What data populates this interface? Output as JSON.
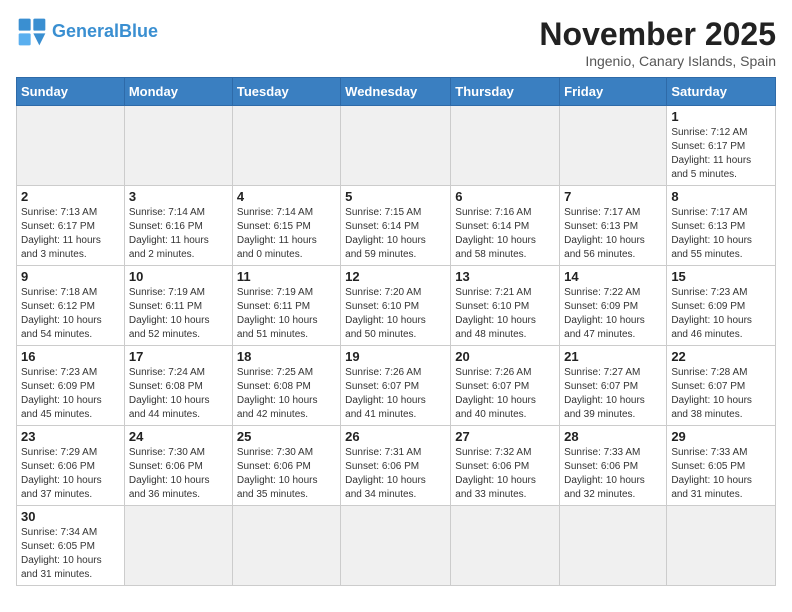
{
  "header": {
    "logo_general": "General",
    "logo_blue": "Blue",
    "month_title": "November 2025",
    "location": "Ingenio, Canary Islands, Spain"
  },
  "days_of_week": [
    "Sunday",
    "Monday",
    "Tuesday",
    "Wednesday",
    "Thursday",
    "Friday",
    "Saturday"
  ],
  "weeks": [
    [
      {
        "day": "",
        "info": ""
      },
      {
        "day": "",
        "info": ""
      },
      {
        "day": "",
        "info": ""
      },
      {
        "day": "",
        "info": ""
      },
      {
        "day": "",
        "info": ""
      },
      {
        "day": "",
        "info": ""
      },
      {
        "day": "1",
        "info": "Sunrise: 7:12 AM\nSunset: 6:17 PM\nDaylight: 11 hours\nand 5 minutes."
      }
    ],
    [
      {
        "day": "2",
        "info": "Sunrise: 7:13 AM\nSunset: 6:17 PM\nDaylight: 11 hours\nand 3 minutes."
      },
      {
        "day": "3",
        "info": "Sunrise: 7:14 AM\nSunset: 6:16 PM\nDaylight: 11 hours\nand 2 minutes."
      },
      {
        "day": "4",
        "info": "Sunrise: 7:14 AM\nSunset: 6:15 PM\nDaylight: 11 hours\nand 0 minutes."
      },
      {
        "day": "5",
        "info": "Sunrise: 7:15 AM\nSunset: 6:14 PM\nDaylight: 10 hours\nand 59 minutes."
      },
      {
        "day": "6",
        "info": "Sunrise: 7:16 AM\nSunset: 6:14 PM\nDaylight: 10 hours\nand 58 minutes."
      },
      {
        "day": "7",
        "info": "Sunrise: 7:17 AM\nSunset: 6:13 PM\nDaylight: 10 hours\nand 56 minutes."
      },
      {
        "day": "8",
        "info": "Sunrise: 7:17 AM\nSunset: 6:13 PM\nDaylight: 10 hours\nand 55 minutes."
      }
    ],
    [
      {
        "day": "9",
        "info": "Sunrise: 7:18 AM\nSunset: 6:12 PM\nDaylight: 10 hours\nand 54 minutes."
      },
      {
        "day": "10",
        "info": "Sunrise: 7:19 AM\nSunset: 6:11 PM\nDaylight: 10 hours\nand 52 minutes."
      },
      {
        "day": "11",
        "info": "Sunrise: 7:19 AM\nSunset: 6:11 PM\nDaylight: 10 hours\nand 51 minutes."
      },
      {
        "day": "12",
        "info": "Sunrise: 7:20 AM\nSunset: 6:10 PM\nDaylight: 10 hours\nand 50 minutes."
      },
      {
        "day": "13",
        "info": "Sunrise: 7:21 AM\nSunset: 6:10 PM\nDaylight: 10 hours\nand 48 minutes."
      },
      {
        "day": "14",
        "info": "Sunrise: 7:22 AM\nSunset: 6:09 PM\nDaylight: 10 hours\nand 47 minutes."
      },
      {
        "day": "15",
        "info": "Sunrise: 7:23 AM\nSunset: 6:09 PM\nDaylight: 10 hours\nand 46 minutes."
      }
    ],
    [
      {
        "day": "16",
        "info": "Sunrise: 7:23 AM\nSunset: 6:09 PM\nDaylight: 10 hours\nand 45 minutes."
      },
      {
        "day": "17",
        "info": "Sunrise: 7:24 AM\nSunset: 6:08 PM\nDaylight: 10 hours\nand 44 minutes."
      },
      {
        "day": "18",
        "info": "Sunrise: 7:25 AM\nSunset: 6:08 PM\nDaylight: 10 hours\nand 42 minutes."
      },
      {
        "day": "19",
        "info": "Sunrise: 7:26 AM\nSunset: 6:07 PM\nDaylight: 10 hours\nand 41 minutes."
      },
      {
        "day": "20",
        "info": "Sunrise: 7:26 AM\nSunset: 6:07 PM\nDaylight: 10 hours\nand 40 minutes."
      },
      {
        "day": "21",
        "info": "Sunrise: 7:27 AM\nSunset: 6:07 PM\nDaylight: 10 hours\nand 39 minutes."
      },
      {
        "day": "22",
        "info": "Sunrise: 7:28 AM\nSunset: 6:07 PM\nDaylight: 10 hours\nand 38 minutes."
      }
    ],
    [
      {
        "day": "23",
        "info": "Sunrise: 7:29 AM\nSunset: 6:06 PM\nDaylight: 10 hours\nand 37 minutes."
      },
      {
        "day": "24",
        "info": "Sunrise: 7:30 AM\nSunset: 6:06 PM\nDaylight: 10 hours\nand 36 minutes."
      },
      {
        "day": "25",
        "info": "Sunrise: 7:30 AM\nSunset: 6:06 PM\nDaylight: 10 hours\nand 35 minutes."
      },
      {
        "day": "26",
        "info": "Sunrise: 7:31 AM\nSunset: 6:06 PM\nDaylight: 10 hours\nand 34 minutes."
      },
      {
        "day": "27",
        "info": "Sunrise: 7:32 AM\nSunset: 6:06 PM\nDaylight: 10 hours\nand 33 minutes."
      },
      {
        "day": "28",
        "info": "Sunrise: 7:33 AM\nSunset: 6:06 PM\nDaylight: 10 hours\nand 32 minutes."
      },
      {
        "day": "29",
        "info": "Sunrise: 7:33 AM\nSunset: 6:05 PM\nDaylight: 10 hours\nand 31 minutes."
      }
    ],
    [
      {
        "day": "30",
        "info": "Sunrise: 7:34 AM\nSunset: 6:05 PM\nDaylight: 10 hours\nand 31 minutes."
      },
      {
        "day": "",
        "info": ""
      },
      {
        "day": "",
        "info": ""
      },
      {
        "day": "",
        "info": ""
      },
      {
        "day": "",
        "info": ""
      },
      {
        "day": "",
        "info": ""
      },
      {
        "day": "",
        "info": ""
      }
    ]
  ]
}
